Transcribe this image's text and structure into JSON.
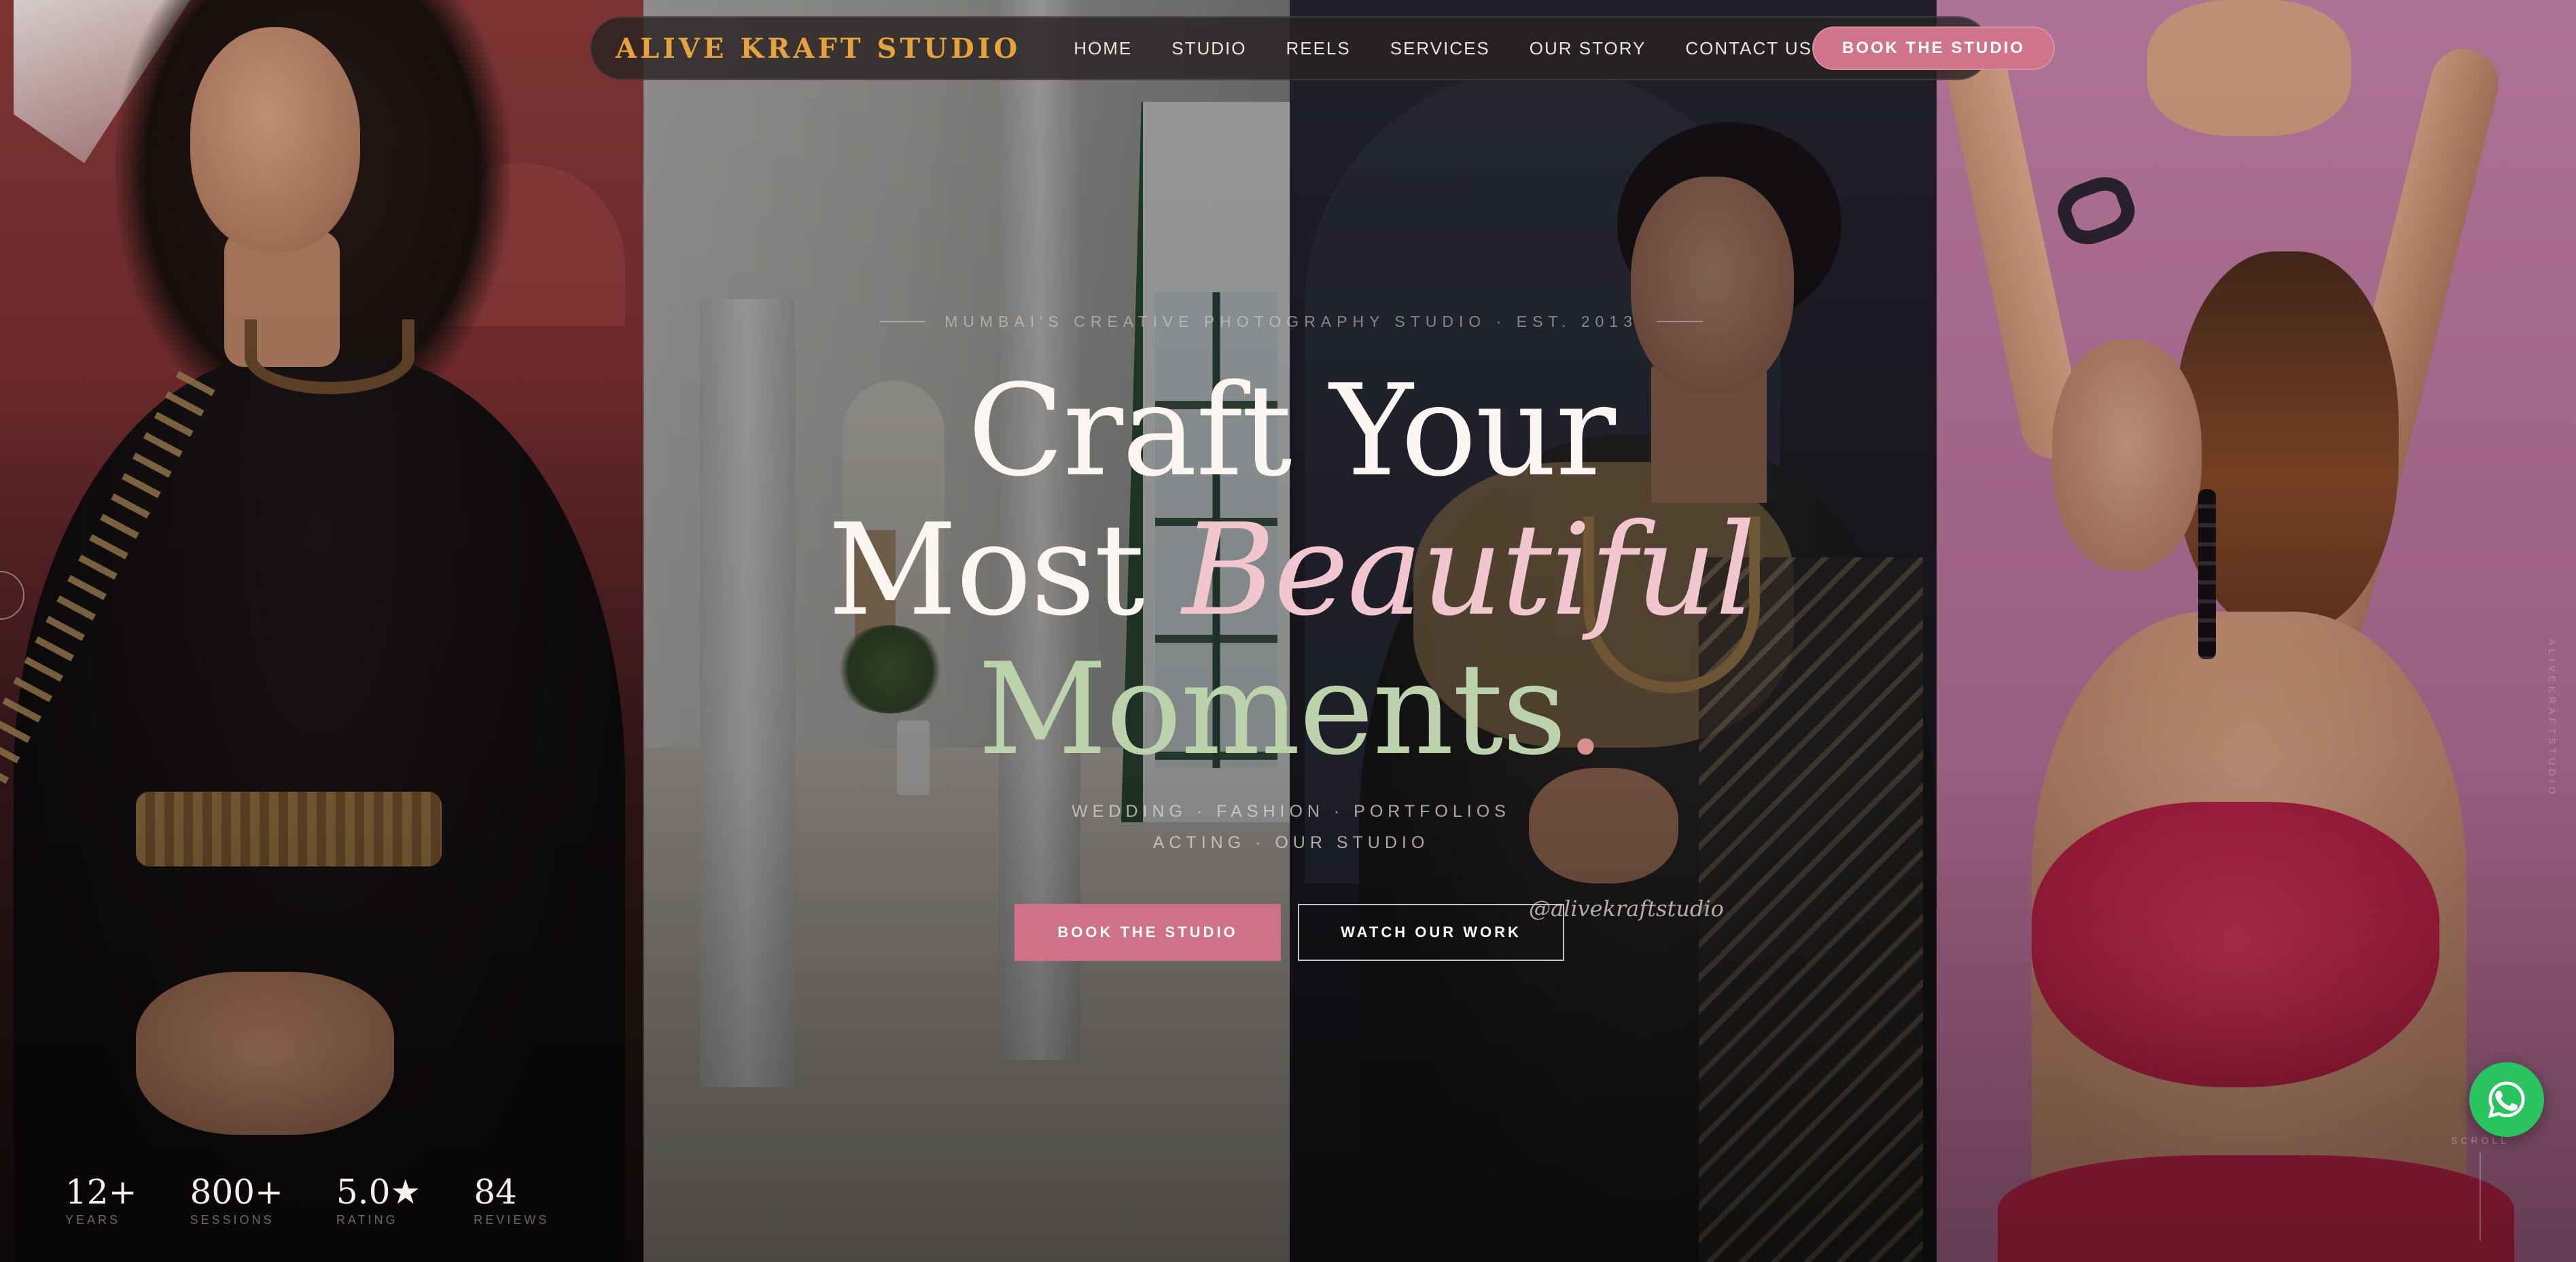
{
  "brand": {
    "name": "ALIVE KRAFT STUDIO",
    "color": "#e6a23c"
  },
  "nav": {
    "items": [
      {
        "label": "HOME"
      },
      {
        "label": "STUDIO"
      },
      {
        "label": "REELS"
      },
      {
        "label": "SERVICES"
      },
      {
        "label": "OUR STORY"
      },
      {
        "label": "CONTACT US"
      }
    ],
    "cta_label": "BOOK THE STUDIO"
  },
  "hero": {
    "eyebrow": "MUMBAI'S CREATIVE PHOTOGRAPHY STUDIO · EST. 2013",
    "headline_line1": "Craft Your",
    "headline_line2_plain": "Most ",
    "headline_line2_accent": "Beautiful",
    "headline_line3": "Moments",
    "headline_line3_dot": ".",
    "services_line1": "WEDDING · FASHION · PORTFOLIOS",
    "services_line2": "ACTING · OUR STUDIO",
    "primary_button": "BOOK THE STUDIO",
    "secondary_button": "WATCH OUR WORK",
    "instagram_handle": "@alivekraftstudio"
  },
  "stats": [
    {
      "value": "12+",
      "label": "YEARS"
    },
    {
      "value": "800+",
      "label": "SESSIONS"
    },
    {
      "value": "5.0★",
      "label": "RATING"
    },
    {
      "value": "84",
      "label": "REVIEWS"
    }
  ],
  "scroll_label": "SCROLL",
  "side_text": "ALIVEKRAFTSTUDIO",
  "icons": {
    "whatsapp": "whatsapp-icon"
  },
  "colors": {
    "accent_pink": "#cf7188",
    "headline_green": "#bcd2ac",
    "headline_pink": "#f2c6cf",
    "whatsapp_green": "#29c35f"
  }
}
